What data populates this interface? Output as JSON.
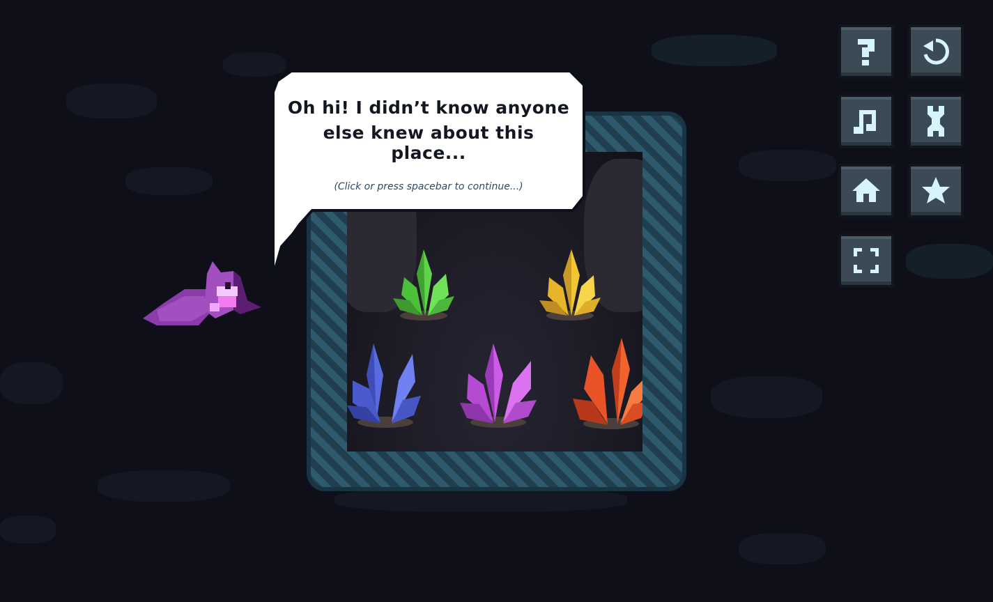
{
  "dialog": {
    "line1": "Oh hi! I didn’t know anyone",
    "line2": "else knew about this place...",
    "hint": "(Click or press spacebar to continue...)"
  },
  "controls": {
    "help": "question-mark-icon",
    "restart": "restart-icon",
    "music": "music-note-icon",
    "settings": "wrench-icon",
    "home": "home-icon",
    "favorites": "star-icon",
    "fullscreen": "fullscreen-icon"
  },
  "crystals": [
    "green",
    "yellow",
    "blue",
    "purple",
    "orange"
  ],
  "colors": {
    "background": "#0f0f1a",
    "button": "#3b4a55",
    "button_icon": "#d8f4fb",
    "bubble": "#ffffff",
    "character": "#a24fc0",
    "crystal_green": "#5fd44a",
    "crystal_yellow": "#f0c632",
    "crystal_blue": "#5a6be0",
    "crystal_purple": "#cb5ce6",
    "crystal_orange": "#f0622e"
  }
}
